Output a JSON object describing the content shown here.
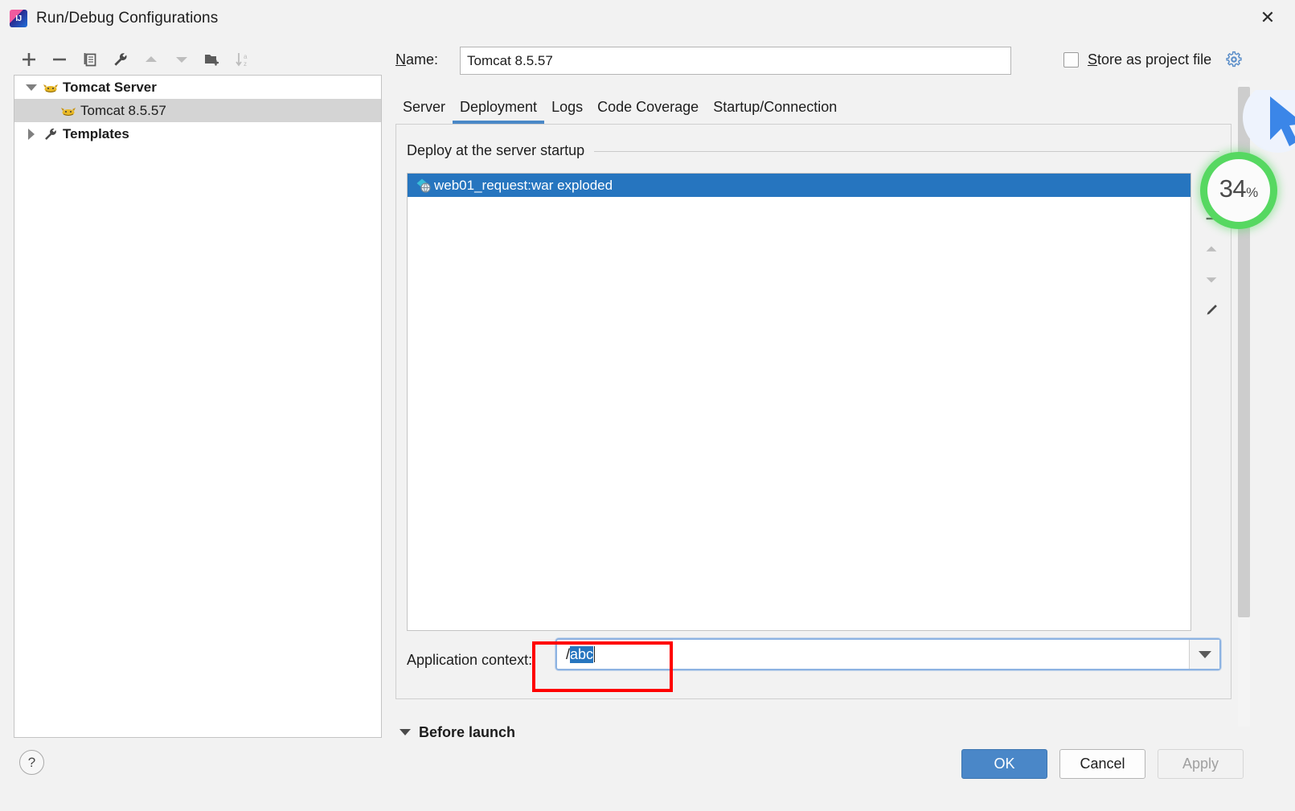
{
  "window": {
    "title": "Run/Debug Configurations",
    "app_icon": "intellij-idea-icon",
    "close_label": "✕"
  },
  "left_toolbar": {
    "buttons": [
      {
        "name": "add-configuration-button",
        "icon": "plus-icon",
        "tooltip": "Add New Configuration",
        "enabled": true
      },
      {
        "name": "remove-configuration-button",
        "icon": "minus-icon",
        "tooltip": "Remove Configuration",
        "enabled": true
      },
      {
        "name": "copy-configuration-button",
        "icon": "copy-icon",
        "tooltip": "Copy Configuration",
        "enabled": true
      },
      {
        "name": "edit-templates-button",
        "icon": "wrench-icon",
        "tooltip": "Edit Templates",
        "enabled": true
      },
      {
        "name": "move-up-button",
        "icon": "arrow-up-icon",
        "tooltip": "Move Up",
        "enabled": false
      },
      {
        "name": "move-down-button",
        "icon": "arrow-down-icon",
        "tooltip": "Move Down",
        "enabled": false
      },
      {
        "name": "new-folder-button",
        "icon": "folder-add-icon",
        "tooltip": "Create New Folder",
        "enabled": true
      },
      {
        "name": "sort-button",
        "icon": "sort-alphabetical-icon",
        "tooltip": "Sort Configurations",
        "enabled": false
      }
    ]
  },
  "tree": {
    "nodes": [
      {
        "label": "Tomcat Server",
        "icon": "tomcat-icon",
        "level": 0,
        "expanded": true,
        "bold": true,
        "selected": false
      },
      {
        "label": "Tomcat 8.5.57",
        "icon": "tomcat-icon",
        "level": 1,
        "expanded": null,
        "bold": false,
        "selected": true
      },
      {
        "label": "Templates",
        "icon": "wrench-icon",
        "level": 0,
        "expanded": false,
        "bold": true,
        "selected": false
      }
    ]
  },
  "help": {
    "label": "?"
  },
  "name_row": {
    "label_prefix": "",
    "label": "Name:",
    "mnemonic": "N",
    "value": "Tomcat 8.5.57"
  },
  "store_as_project_file": {
    "label": "Store as project file",
    "mnemonic": "S",
    "checked": false,
    "gear_icon": "gear-icon"
  },
  "tabs": [
    {
      "label": "Server",
      "active": false
    },
    {
      "label": "Deployment",
      "active": true
    },
    {
      "label": "Logs",
      "active": false
    },
    {
      "label": "Code Coverage",
      "active": false
    },
    {
      "label": "Startup/Connection",
      "active": false
    }
  ],
  "deployment": {
    "group_title": "Deploy at the server startup",
    "items": [
      {
        "label": "web01_request:war exploded",
        "icon": "artifact-icon",
        "selected": true
      }
    ],
    "side_tools": [
      {
        "name": "add-artifact-button",
        "icon": "plus-icon",
        "enabled": true
      },
      {
        "name": "remove-artifact-button",
        "icon": "minus-icon",
        "enabled": true
      },
      {
        "name": "move-artifact-up-button",
        "icon": "arrow-up-icon",
        "enabled": false
      },
      {
        "name": "move-artifact-down-button",
        "icon": "arrow-down-icon",
        "enabled": false
      },
      {
        "name": "edit-artifact-button",
        "icon": "pencil-icon",
        "enabled": true
      }
    ],
    "application_context": {
      "label": "Application context:",
      "value_prefix": "/",
      "value_selected": "abc",
      "full_value": "/abc",
      "dropdown_icon": "chevron-down-icon"
    }
  },
  "before_launch": {
    "label": "Before launch",
    "expanded": true
  },
  "footer_buttons": {
    "ok": "OK",
    "cancel": "Cancel",
    "apply": "Apply",
    "apply_enabled": false
  },
  "overlay": {
    "progress_value": "34",
    "progress_symbol": "%",
    "progress_color": "#56d861",
    "cursor_icon": "mouse-cursor-icon"
  },
  "colors": {
    "accent_blue": "#2675bf",
    "tab_underline": "#4a88c7",
    "ok_button": "#4a87c8",
    "selection_gray": "#d4d4d4",
    "annotation_red": "#ff0000",
    "progress_green": "#56d861",
    "window_bg": "#f2f2f2"
  }
}
